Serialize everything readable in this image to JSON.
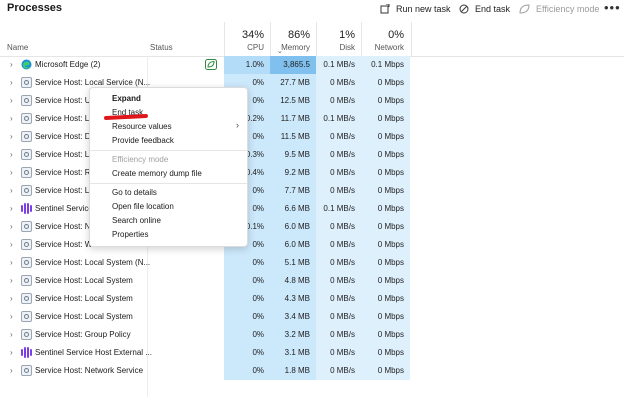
{
  "topbar": {
    "title": "Processes",
    "run_new_task": "Run new task",
    "end_task": "End task",
    "efficiency_mode": "Efficiency mode",
    "more": "•••"
  },
  "columns": {
    "name": "Name",
    "status": "Status",
    "cpu": {
      "pct": "34%",
      "label": "CPU"
    },
    "memory": {
      "pct": "86%",
      "label": "Memory"
    },
    "disk": {
      "pct": "1%",
      "label": "Disk"
    },
    "network": {
      "pct": "0%",
      "label": "Network"
    }
  },
  "rows": [
    {
      "name": "Microsoft Edge (2)",
      "icon": "edge-icon",
      "status": "efficiency-leaf-icon",
      "cpu": "1.0%",
      "mem": "3,865.5 MB",
      "disk": "0.1 MB/s",
      "net": "0.1 Mbps"
    },
    {
      "name": "Service Host: Local Service (N...",
      "icon": "service-host-icon",
      "cpu": "0%",
      "mem": "27.7 MB",
      "disk": "0 MB/s",
      "net": "0 Mbps"
    },
    {
      "name": "Service Host: Ut",
      "icon": "service-host-icon",
      "cpu": "0%",
      "mem": "12.5 MB",
      "disk": "0 MB/s",
      "net": "0 Mbps"
    },
    {
      "name": "Service Host: Lo",
      "icon": "service-host-icon",
      "cpu": "0.2%",
      "mem": "11.7 MB",
      "disk": "0.1 MB/s",
      "net": "0 Mbps"
    },
    {
      "name": "Service Host: DC",
      "icon": "service-host-icon",
      "cpu": "0%",
      "mem": "11.5 MB",
      "disk": "0 MB/s",
      "net": "0 Mbps"
    },
    {
      "name": "Service Host: Lo",
      "icon": "service-host-icon",
      "cpu": "0.3%",
      "mem": "9.5 MB",
      "disk": "0 MB/s",
      "net": "0 Mbps"
    },
    {
      "name": "Service Host: Re",
      "icon": "service-host-icon",
      "cpu": "0.4%",
      "mem": "9.2 MB",
      "disk": "0 MB/s",
      "net": "0 Mbps"
    },
    {
      "name": "Service Host: Lo",
      "icon": "service-host-icon",
      "cpu": "0%",
      "mem": "7.7 MB",
      "disk": "0 MB/s",
      "net": "0 Mbps"
    },
    {
      "name": "Sentinel Service",
      "icon": "sentinel-icon",
      "cpu": "0%",
      "mem": "6.6 MB",
      "disk": "0.1 MB/s",
      "net": "0 Mbps"
    },
    {
      "name": "Service Host: Ne",
      "icon": "service-host-icon",
      "cpu": "0.1%",
      "mem": "6.0 MB",
      "disk": "0 MB/s",
      "net": "0 Mbps"
    },
    {
      "name": "Service Host: Windows Push No...",
      "icon": "service-host-icon",
      "cpu": "0%",
      "mem": "6.0 MB",
      "disk": "0 MB/s",
      "net": "0 Mbps"
    },
    {
      "name": "Service Host: Local System (N...",
      "icon": "service-host-icon",
      "cpu": "0%",
      "mem": "5.1 MB",
      "disk": "0 MB/s",
      "net": "0 Mbps"
    },
    {
      "name": "Service Host: Local System",
      "icon": "service-host-icon",
      "cpu": "0%",
      "mem": "4.8 MB",
      "disk": "0 MB/s",
      "net": "0 Mbps"
    },
    {
      "name": "Service Host: Local System",
      "icon": "service-host-icon",
      "cpu": "0%",
      "mem": "4.3 MB",
      "disk": "0 MB/s",
      "net": "0 Mbps"
    },
    {
      "name": "Service Host: Local System",
      "icon": "service-host-icon",
      "cpu": "0%",
      "mem": "3.4 MB",
      "disk": "0 MB/s",
      "net": "0 Mbps"
    },
    {
      "name": "Service Host: Group Policy",
      "icon": "service-host-icon",
      "cpu": "0%",
      "mem": "3.2 MB",
      "disk": "0 MB/s",
      "net": "0 Mbps"
    },
    {
      "name": "Sentinel Service Host External ...",
      "icon": "sentinel-icon",
      "cpu": "0%",
      "mem": "3.1 MB",
      "disk": "0 MB/s",
      "net": "0 Mbps"
    },
    {
      "name": "Service Host: Network Service",
      "icon": "service-host-icon",
      "cpu": "0%",
      "mem": "1.8 MB",
      "disk": "0 MB/s",
      "net": "0 Mbps"
    }
  ],
  "context_menu": {
    "expand": "Expand",
    "end_task": "End task",
    "resource_values": "Resource values",
    "provide_feedback": "Provide feedback",
    "efficiency_mode": "Efficiency mode",
    "create_dump": "Create memory dump file",
    "go_to_details": "Go to details",
    "open_file_location": "Open file location",
    "search_online": "Search online",
    "properties": "Properties"
  },
  "colors": {
    "cpu_column": "#cce8fb",
    "memory_highlight": "#7fc0ef",
    "annotation_red": "#e0161d",
    "sentinel_purple": "#7b3fe4"
  }
}
